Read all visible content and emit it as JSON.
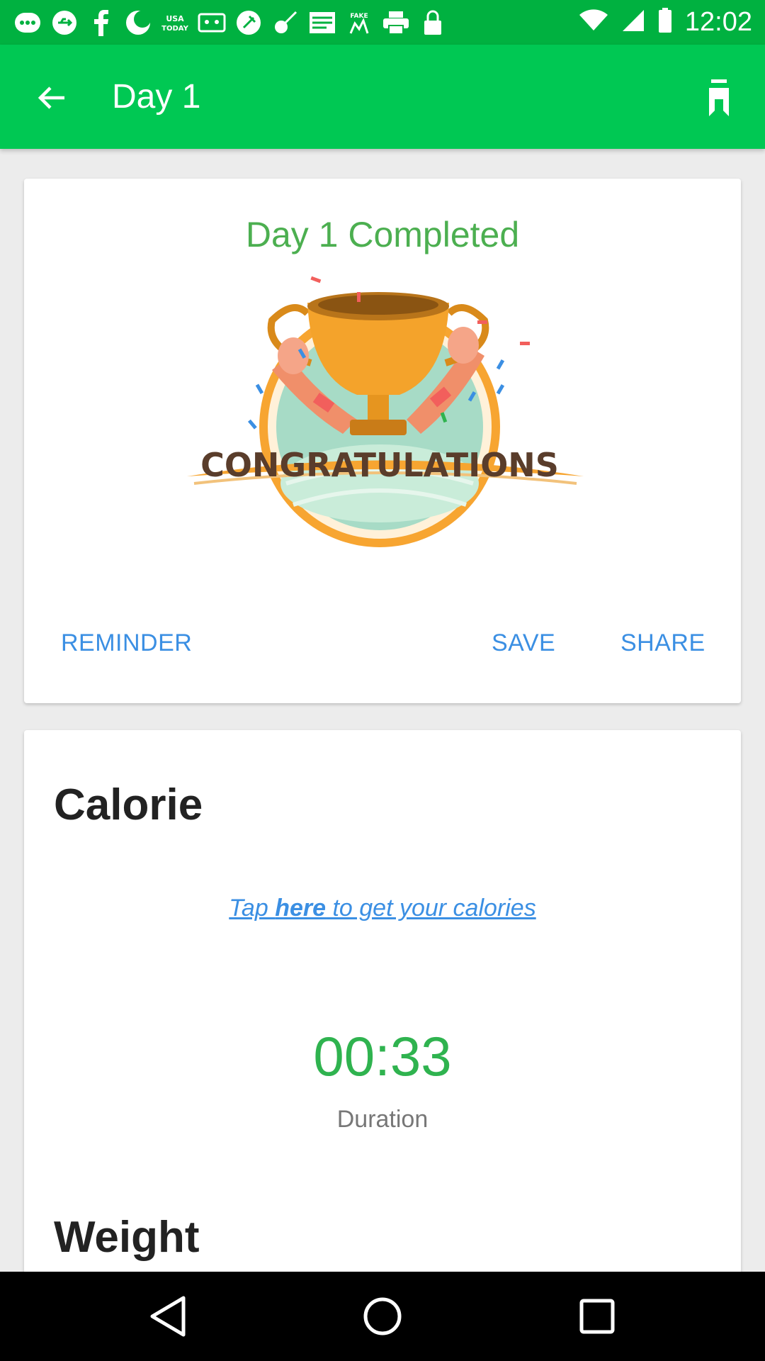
{
  "status_bar": {
    "time": "12:02",
    "left_icons": [
      "messages-icon",
      "usb-icon",
      "facebook-icon",
      "moon-icon",
      "usa-today-icon",
      "cassette-icon",
      "satellite-icon",
      "guitar-icon",
      "news-icon",
      "fake-gps-icon",
      "print-icon",
      "lock-icon"
    ],
    "right_icons": [
      "wifi-icon",
      "signal-icon",
      "battery-icon"
    ]
  },
  "app_bar": {
    "title": "Day 1",
    "accent": "#00c853"
  },
  "completion_card": {
    "title": "Day 1 Completed",
    "badge_text": "CONGRATULATIONS",
    "actions": {
      "reminder": "REMINDER",
      "save": "SAVE",
      "share": "SHARE"
    }
  },
  "stats_card": {
    "calorie_title": "Calorie",
    "tap_prefix": "Tap ",
    "tap_bold": "here",
    "tap_suffix": " to get your calories",
    "duration_value": "00:33",
    "duration_label": "Duration",
    "weight_title": "Weight"
  },
  "colors": {
    "green_text": "#4caf50",
    "link_blue": "#3b8fe3",
    "status_green": "#00b140"
  }
}
